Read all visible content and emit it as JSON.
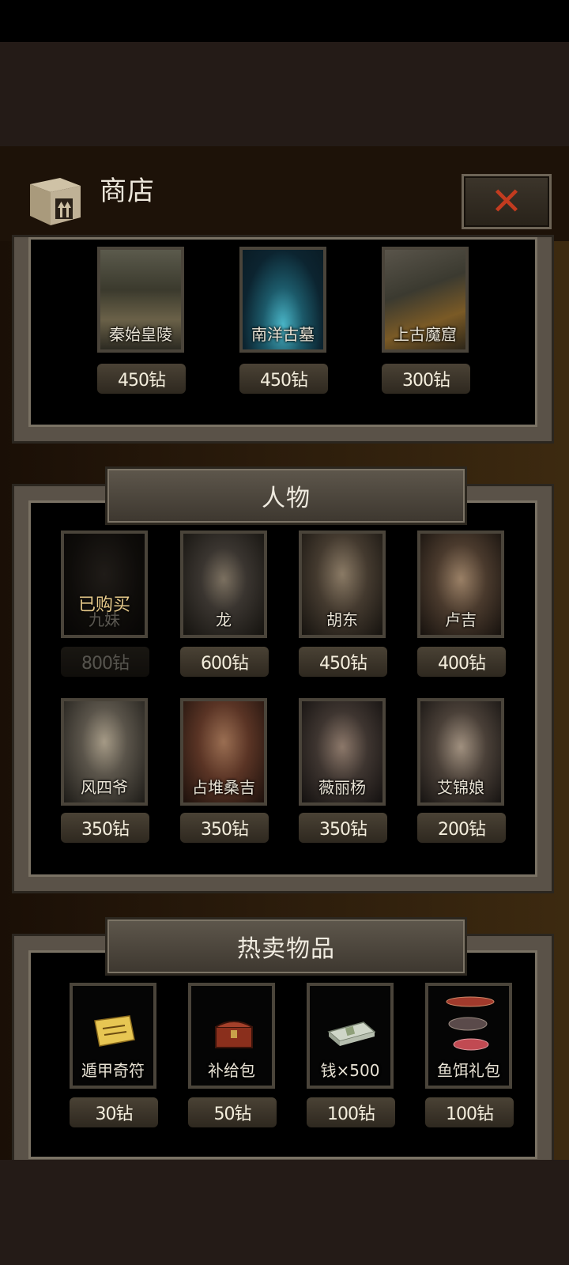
{
  "header": {
    "title": "商店"
  },
  "close_icon": "close-icon",
  "scenes": [
    {
      "name": "秦始皇陵",
      "price": "450钻"
    },
    {
      "name": "南洋古墓",
      "price": "450钻"
    },
    {
      "name": "上古魔窟",
      "price": "300钻"
    }
  ],
  "characters_section": {
    "title": "人物",
    "items": [
      {
        "name": "九妹",
        "price": "800钻",
        "status": "已购买"
      },
      {
        "name": "龙",
        "price": "600钻"
      },
      {
        "name": "胡东",
        "price": "450钻"
      },
      {
        "name": "卢吉",
        "price": "400钻"
      },
      {
        "name": "风四爷",
        "price": "350钻"
      },
      {
        "name": "占堆桑吉",
        "price": "350钻"
      },
      {
        "name": "薇丽杨",
        "price": "350钻"
      },
      {
        "name": "艾锦娘",
        "price": "200钻"
      }
    ]
  },
  "hot_section": {
    "title": "热卖物品",
    "items": [
      {
        "name": "遁甲奇符",
        "price": "30钻"
      },
      {
        "name": "补给包",
        "price": "50钻"
      },
      {
        "name": "钱×500",
        "price": "100钻"
      },
      {
        "name": "鱼饵礼包",
        "price": "100钻"
      }
    ]
  }
}
